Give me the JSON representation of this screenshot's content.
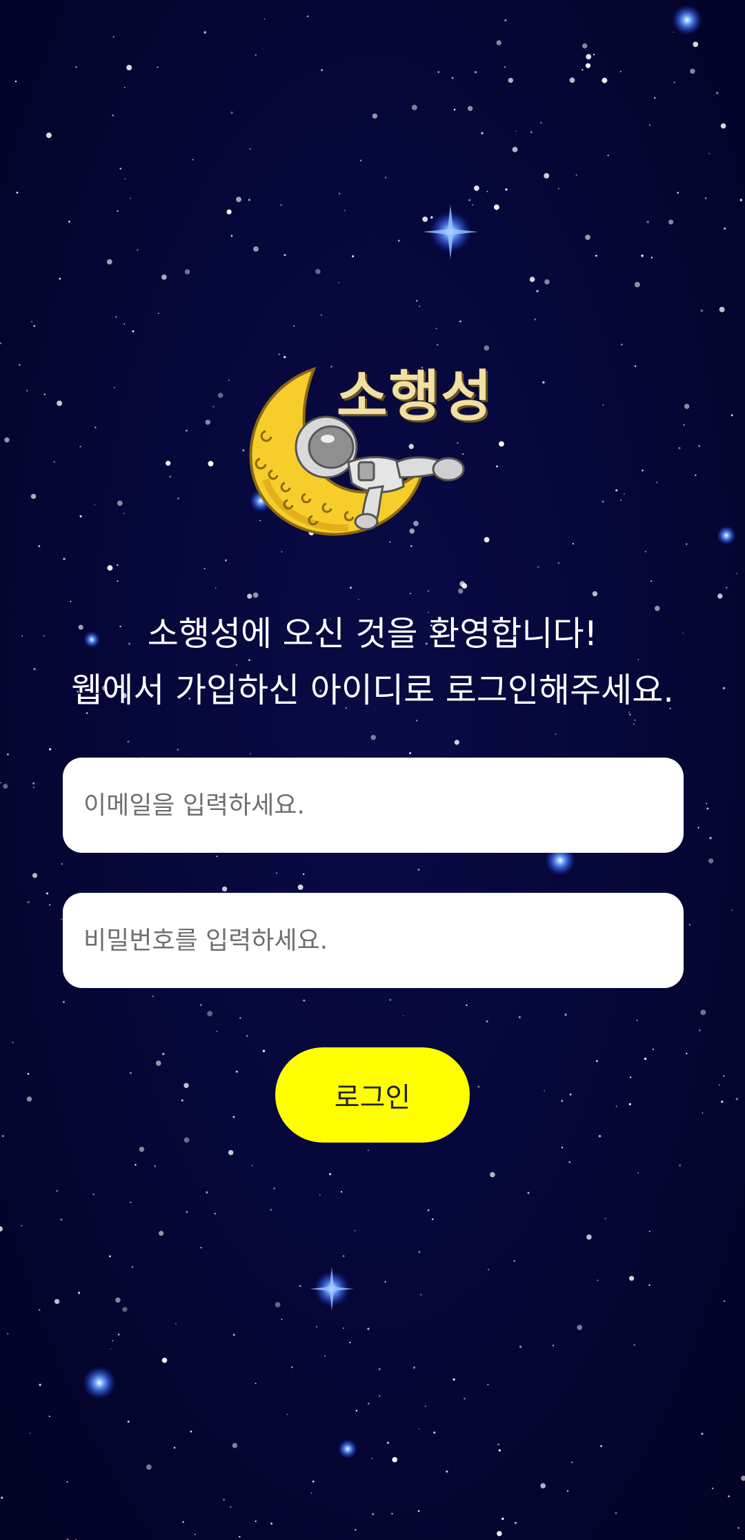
{
  "app": {
    "brand_name": "소행성",
    "logo_icon": "moon-astronaut-icon"
  },
  "welcome": {
    "line1": "소행성에 오신 것을 환영합니다!",
    "line2": "웹에서 가입하신 아이디로 로그인해주세요."
  },
  "form": {
    "email_placeholder": "이메일을 입력하세요.",
    "email_value": "",
    "password_placeholder": "비밀번호를 입력하세요.",
    "password_value": "",
    "login_label": "로그인"
  },
  "colors": {
    "background": "#06073a",
    "button": "#ffff00",
    "brand_text": "#f2dfa4",
    "moon": "#f6cd2b"
  }
}
